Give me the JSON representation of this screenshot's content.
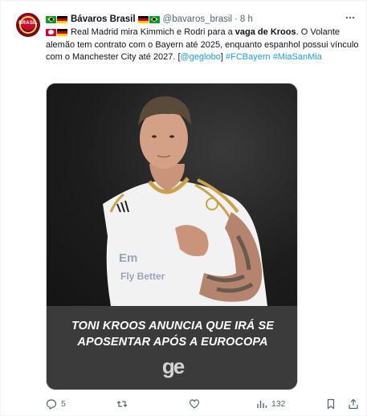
{
  "author": {
    "display_name": "Bávaros Brasil",
    "handle": "@bavaros_brasil",
    "time": "8 h",
    "separator": "·",
    "avatar_text": "BRASIL"
  },
  "tweet": {
    "segments": [
      {
        "text": "Real Madrid mira Kimmich e Rodri para a ",
        "style": "normal"
      },
      {
        "text": "vaga de Kroos",
        "style": "bold"
      },
      {
        "text": ". O Volante alemão tem contrato com o Bayern até 2025, enquanto espanhol possui vínculo com o Manchester City até 2027. [",
        "style": "normal"
      },
      {
        "text": "@geglobo",
        "style": "link"
      },
      {
        "text": "] ",
        "style": "normal"
      },
      {
        "text": "#FCBayern",
        "style": "link"
      },
      {
        "text": " ",
        "style": "normal"
      },
      {
        "text": "#MiaSanMia",
        "style": "link"
      }
    ]
  },
  "media": {
    "headline_line1": "TONI KROOS ANUNCIA QUE IRÁ SE",
    "headline_line2": "APOSENTAR APÓS A EUROCOPA",
    "logo_text": "ge"
  },
  "actions": {
    "replies": "5",
    "reposts": "",
    "likes": "",
    "views": "132"
  },
  "icons": [
    "more-icon",
    "reply-icon",
    "repost-icon",
    "like-icon",
    "views-icon"
  ],
  "colors": {
    "link": "#1d9bf0",
    "secondary_text": "#536471",
    "caption_bg": "#3b3b3b"
  }
}
